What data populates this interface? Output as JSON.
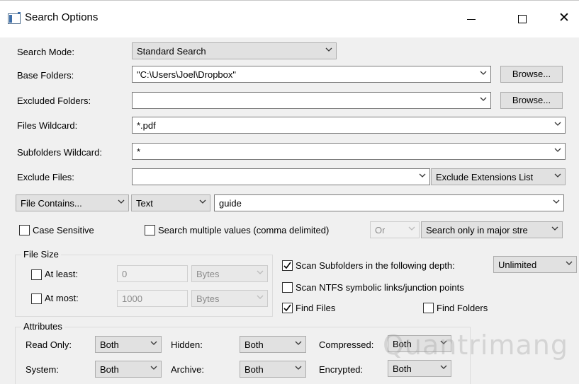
{
  "window": {
    "title": "Search Options",
    "minimize_icon": "minimize-icon",
    "maximize_icon": "maximize-icon",
    "close_symbol": "✕"
  },
  "labels": {
    "search_mode": "Search Mode:",
    "base_folders": "Base Folders:",
    "excluded_folders": "Excluded Folders:",
    "files_wildcard": "Files Wildcard:",
    "subfolders_wildcard": "Subfolders Wildcard:",
    "exclude_files": "Exclude Files:"
  },
  "fields": {
    "search_mode": "Standard Search",
    "base_folders": "\"C:\\Users\\Joel\\Dropbox\"",
    "excluded_folders": "",
    "files_wildcard": "*.pdf",
    "subfolders_wildcard": "*",
    "exclude_files": "",
    "exclude_type": "Exclude Extensions List",
    "contains_mode": "File Contains...",
    "contains_type": "Text",
    "contains_value": "guide",
    "multi_operator": "Or",
    "stream_mode": "Search only in major stre "
  },
  "buttons": {
    "browse": "Browse..."
  },
  "options": {
    "case_sensitive": "Case Sensitive",
    "search_multiple": "Search multiple values (comma delimited)"
  },
  "file_size": {
    "title": "File Size",
    "at_least": {
      "label": "At least:",
      "value": "0",
      "unit": "Bytes"
    },
    "at_most": {
      "label": "At most:",
      "value": "1000",
      "unit": "Bytes"
    }
  },
  "scan": {
    "subfolders": "Scan Subfolders in the following depth:",
    "depth": "Unlimited",
    "ntfs": "Scan NTFS symbolic links/junction points",
    "find_files": "Find Files",
    "find_folders": "Find Folders"
  },
  "attributes": {
    "title": "Attributes",
    "read_only": {
      "label": "Read Only:",
      "value": "Both"
    },
    "hidden": {
      "label": "Hidden:",
      "value": "Both"
    },
    "compressed": {
      "label": "Compressed:",
      "value": "Both"
    },
    "system": {
      "label": "System:",
      "value": "Both"
    },
    "archive": {
      "label": "Archive:",
      "value": "Both"
    },
    "encrypted": {
      "label": "Encrypted:",
      "value": "Both"
    }
  },
  "watermark": "Quantrimang",
  "colors": {
    "checkmark": "#000000",
    "chevron": "#333333"
  }
}
